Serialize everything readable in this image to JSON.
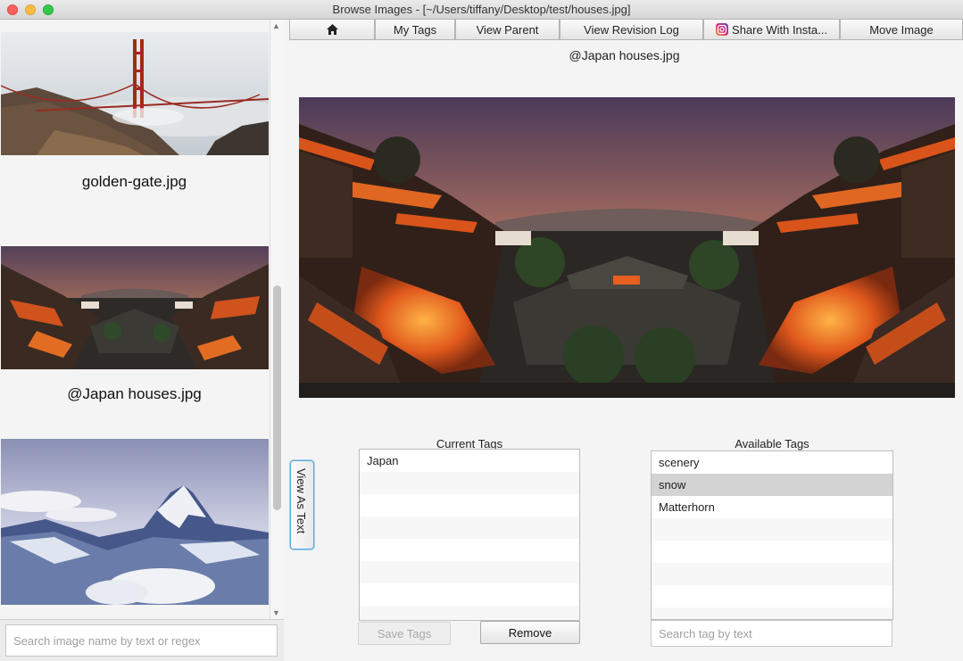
{
  "window": {
    "title": "Browse Images - [~/Users/tiffany/Desktop/test/houses.jpg]"
  },
  "image_list": {
    "items": [
      {
        "label": "golden-gate.jpg",
        "icon": "golden-gate-bridge-photo"
      },
      {
        "label": "@Japan houses.jpg",
        "icon": "japan-houses-photo"
      },
      {
        "label": "",
        "icon": "matterhorn-mountain-photo"
      }
    ],
    "search_placeholder": "Search image name by text or regex"
  },
  "toolbar": {
    "home_icon": "home-icon",
    "my_tags": "My Tags",
    "view_parent": "View Parent",
    "view_revision_log": "View Revision Log",
    "share": "Share With Insta...",
    "share_icon": "instagram-icon",
    "move_image": "Move Image"
  },
  "viewer": {
    "title": "@Japan houses.jpg",
    "view_as_text": "View As Text"
  },
  "current_tags": {
    "title": "Current Tags",
    "items": [
      "Japan"
    ],
    "save_label": "Save Tags",
    "remove_label": "Remove"
  },
  "available_tags": {
    "title": "Available Tags",
    "items": [
      "scenery",
      "snow",
      "Matterhorn"
    ],
    "selected": "snow",
    "search_placeholder": "Search tag by text"
  },
  "colors": {
    "accent": "#5aa9d8",
    "selected_row": "#d3d3d3"
  }
}
